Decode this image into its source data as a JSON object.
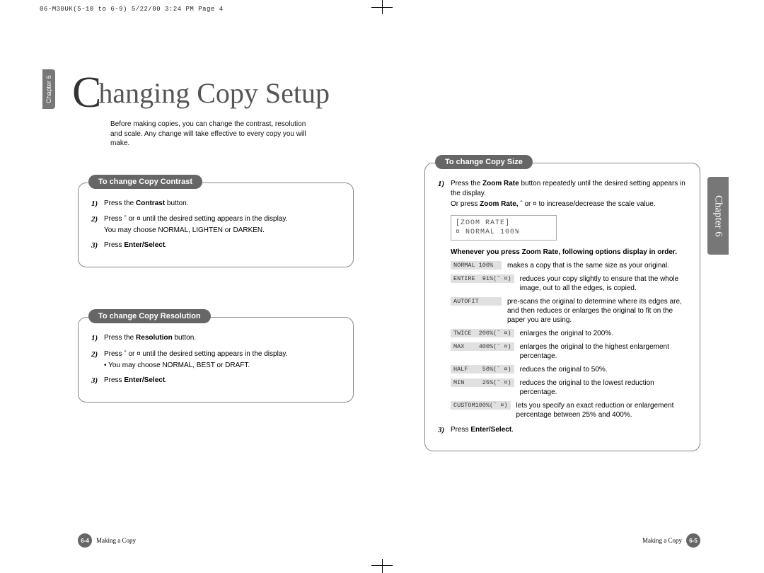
{
  "meta": {
    "stamp": "06-M30UK(5-10 to 6-9)  5/22/00 3:24 PM  Page 4"
  },
  "side_tabs": {
    "left": "Chapter 6",
    "right": "Chapter 6"
  },
  "heading": {
    "cap": "C",
    "rest": "hanging Copy Setup"
  },
  "intro": "Before making copies, you can change the contrast, resolution and scale. Any change will take effective to every copy you will make.",
  "left_boxes": [
    {
      "title": "To change Copy Contrast",
      "steps": [
        {
          "num": "1)",
          "html": "Press the <b>Contrast</b> button."
        },
        {
          "num": "2)",
          "html": "Press ˆ or ¤ until the desired setting appears in the display.",
          "sub": "You may choose NORMAL, LIGHTEN or DARKEN."
        },
        {
          "num": "3)",
          "html": "Press <b>Enter/Select</b>."
        }
      ]
    },
    {
      "title": "To change Copy Resolution",
      "steps": [
        {
          "num": "1)",
          "html": "Press the <b>Resolution</b> button."
        },
        {
          "num": "2)",
          "html": "Press ˆ or ¤ until the desired setting appears in the display.",
          "sub": "• You may choose NORMAL, BEST or DRAFT."
        },
        {
          "num": "3)",
          "html": "Press <b>Enter/Select</b>."
        }
      ]
    }
  ],
  "right_box": {
    "title": "To change Copy Size",
    "step1": {
      "num": "1)",
      "line1": "Press the <b>Zoom Rate</b> button repeatedly until the desired setting appears in the display.",
      "line2": "Or press <b>Zoom Rate,</b> ˆ or ¤ to increase/decrease the scale value."
    },
    "lcd": "[ZOOM RATE]\n¤ NORMAL 100%",
    "note": "Whenever you press Zoom Rate, following options display in order.",
    "options": [
      {
        "label": "NORMAL 100%",
        "desc": "makes a copy that is the same size as your original."
      },
      {
        "label": "ENTIRE  91%(ˆ ¤)",
        "desc": "reduces your copy slightly to ensure that the whole image, out to all the edges, is copied."
      },
      {
        "label": "AUTOFIT",
        "desc": "pre-scans the original to determine where its edges are, and then reduces or enlarges the original to fit on the paper you are using."
      },
      {
        "label": "TWICE  200%(ˆ ¤)",
        "desc": "enlarges the original to 200%."
      },
      {
        "label": "MAX    400%(ˆ ¤)",
        "desc": "enlarges the original to the highest enlargement percentage."
      },
      {
        "label": "HALF    50%(ˆ ¤)",
        "desc": "reduces the original to 50%."
      },
      {
        "label": "MIN     25%(ˆ ¤)",
        "desc": "reduces the original to the lowest reduction percentage."
      },
      {
        "label": "CUSTOM100%(ˆ ¤)",
        "desc": "lets you specify an exact reduction or enlargement percentage between 25% and 400%."
      }
    ],
    "step3": {
      "num": "3)",
      "html": "Press <b>Enter/Select</b>."
    }
  },
  "footer": {
    "left_page": "6-4",
    "right_page": "6-5",
    "section": "Making a Copy"
  }
}
